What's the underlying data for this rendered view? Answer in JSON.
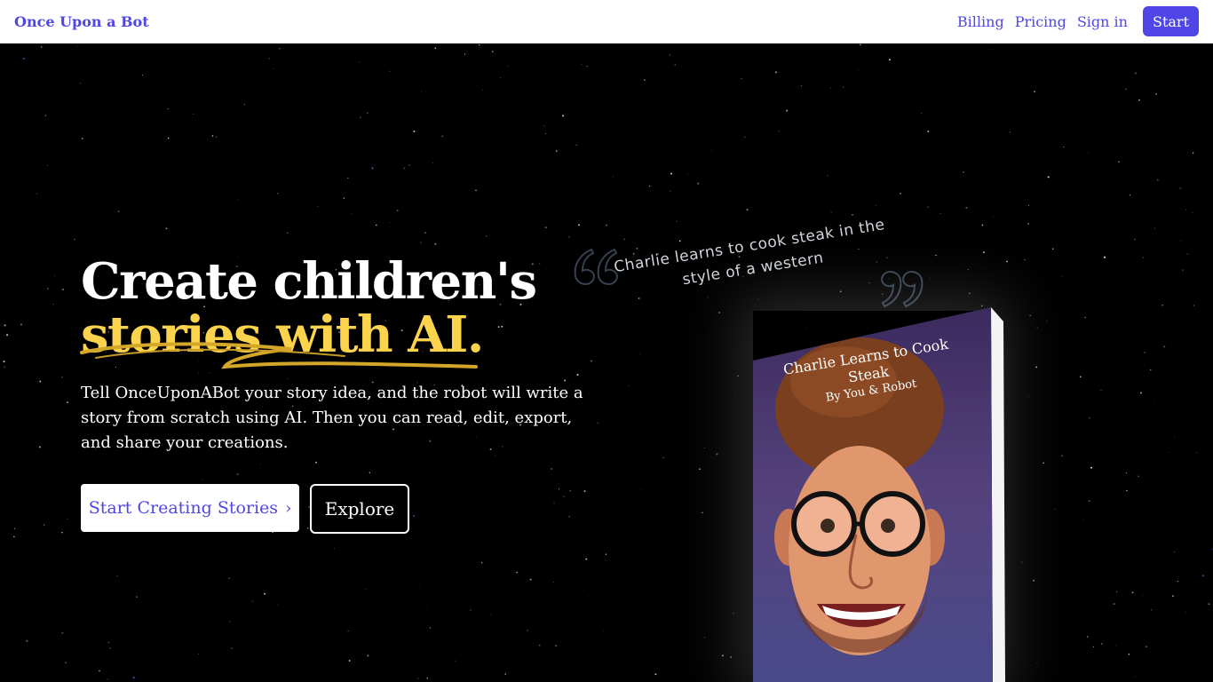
{
  "nav": {
    "brand": "Once Upon a Bot",
    "links": [
      "Billing",
      "Pricing",
      "Sign in"
    ],
    "start_label": "Start",
    "accent_color": "#4f46e5"
  },
  "hero": {
    "headline_line1": "Create children's",
    "headline_line2": "stories with AI.",
    "highlight_color": "#fcd34d",
    "description": "Tell OnceUponABot your story idea, and the robot will write a story from scratch using AI. Then you can read, edit, export, and share your creations.",
    "primary_button": "Start Creating Stories",
    "primary_button_icon": "chevron-right-icon",
    "secondary_button": "Explore"
  },
  "quote": {
    "text": "Charlie learns to cook steak in the style of a western",
    "open_icon": "open-quote-icon",
    "close_icon": "close-quote-icon"
  },
  "book": {
    "title": "Charlie Learns to Cook Steak",
    "author": "By You & Robot",
    "cover_icon": "book-cover-illustration"
  }
}
